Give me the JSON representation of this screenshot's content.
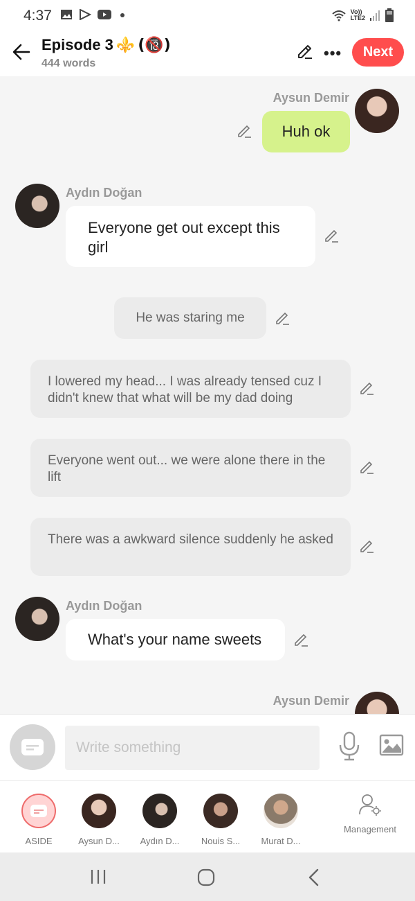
{
  "status_bar": {
    "time": "4:37",
    "network_top": "Vo))",
    "network_bottom": "LTE2",
    "icons": [
      "image-icon",
      "play-store-icon",
      "youtube-icon",
      "dot-icon",
      "wifi-icon",
      "signal-icon",
      "battery-icon"
    ]
  },
  "header": {
    "title": "Episode 3",
    "title_emoji": "⚜️",
    "title_rating": "(🔞)",
    "subtitle": "444 words",
    "next_label": "Next",
    "accent_color": "#ff4d4d"
  },
  "chat": {
    "messages": [
      {
        "type": "right",
        "speaker": "Aysun Demir",
        "text": "Huh ok",
        "bubble_color": "#d6f28c"
      },
      {
        "type": "left",
        "speaker": "Aydın Doğan",
        "text": "Everyone get out except this girl"
      },
      {
        "type": "narration",
        "text": "He was staring me"
      },
      {
        "type": "narration",
        "text": "I lowered my head... I was already tensed cuz I didn't knew that what will be my dad doing"
      },
      {
        "type": "narration",
        "text": "Everyone went out... we were alone there in the lift"
      },
      {
        "type": "narration",
        "text": "There was a awkward silence suddenly he asked"
      },
      {
        "type": "left",
        "speaker": "Aydın Doğan",
        "text": "What's your name sweets"
      },
      {
        "type": "right",
        "speaker": "Aysun Demir",
        "text": ""
      }
    ]
  },
  "composer": {
    "placeholder": "Write something",
    "value": ""
  },
  "characters": {
    "items": [
      {
        "label": "ASIDE"
      },
      {
        "label": "Aysun D..."
      },
      {
        "label": "Aydın D..."
      },
      {
        "label": "Nouis S..."
      },
      {
        "label": "Murat D..."
      }
    ],
    "management_label": "Management"
  }
}
